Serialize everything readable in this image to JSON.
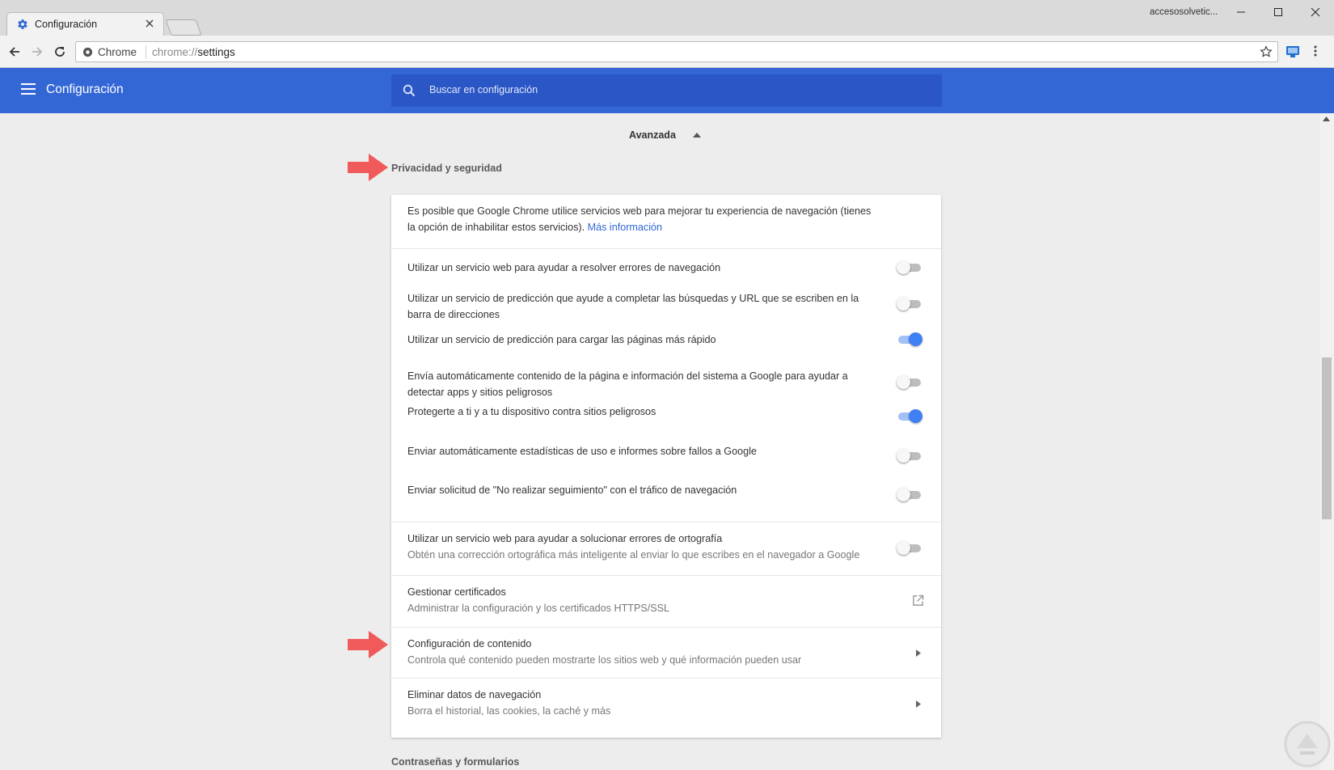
{
  "browser": {
    "tab_title": "Configuración",
    "profile_name": "accesosolvetic...",
    "omnibox_origin": "Chrome",
    "url_scheme": "chrome://",
    "url_host": "settings"
  },
  "header": {
    "title": "Configuración",
    "search_placeholder": "Buscar en configuración",
    "color": "#3367d6"
  },
  "advanced": {
    "label": "Avanzada"
  },
  "privacy": {
    "title": "Privacidad y seguridad",
    "intro_text": "Es posible que Google Chrome utilice servicios web para mejorar tu experiencia de navegación (tienes la opción de inhabilitar estos servicios).",
    "intro_link": "Más información",
    "toggles": [
      {
        "label": "Utilizar un servicio web para ayudar a resolver errores de navegación",
        "on": false
      },
      {
        "label": "Utilizar un servicio de predicción que ayude a completar las búsquedas y URL que se escriben en la barra de direcciones",
        "on": false
      },
      {
        "label": "Utilizar un servicio de predicción para cargar las páginas más rápido",
        "on": true
      },
      {
        "label": "Envía automáticamente contenido de la página e información del sistema a Google para ayudar a detectar apps y sitios peligrosos",
        "on": false
      },
      {
        "label": "Protegerte a ti y a tu dispositivo contra sitios peligrosos",
        "on": true
      },
      {
        "label": "Enviar automáticamente estadísticas de uso e informes sobre fallos a Google",
        "on": false
      },
      {
        "label": "Enviar solicitud de \"No realizar seguimiento\" con el tráfico de navegación",
        "on": false
      }
    ],
    "spelling": {
      "label": "Utilizar un servicio web para ayudar a solucionar errores de ortografía",
      "sub": "Obtén una corrección ortográfica más inteligente al enviar lo que escribes en el navegador a Google",
      "on": false
    },
    "certificates": {
      "label": "Gestionar certificados",
      "sub": "Administrar la configuración y los certificados HTTPS/SSL",
      "icon": "open-in-new-icon"
    },
    "content_settings": {
      "label": "Configuración de contenido",
      "sub": "Controla qué contenido pueden mostrarte los sitios web y qué información pueden usar",
      "icon": "chevron-right-icon"
    },
    "clear_data": {
      "label": "Eliminar datos de navegación",
      "sub": "Borra el historial, las cookies, la caché y más",
      "icon": "chevron-right-icon"
    }
  },
  "next_section": {
    "title": "Contraseñas y formularios"
  },
  "colors": {
    "toggle_on": "#3f80f4",
    "annotation_arrow": "#f05a5a"
  }
}
